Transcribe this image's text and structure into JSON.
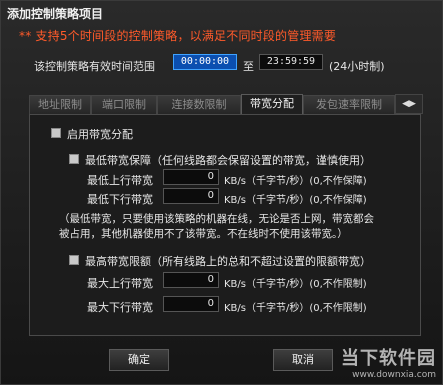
{
  "window": {
    "title": "添加控制策略项目"
  },
  "notice": "** 支持5个时间段的控制策略，以满足不同时段的管理需要",
  "time_range": {
    "label": "该控制策略有效时间范围",
    "start": "00:00:00",
    "to": "至",
    "end": "23:59:59",
    "hint": "(24小时制)"
  },
  "tabs": [
    "地址限制",
    "端口限制",
    "连接数限制",
    "带宽分配",
    "发包速率限制"
  ],
  "selected_tab": "带宽分配",
  "bandwidth": {
    "enable_label": "启用带宽分配",
    "min": {
      "label": "最低带宽保障（任何线路都会保留设置的带宽，谨慎使用）",
      "up_label": "最低上行带宽",
      "up_value": "0",
      "down_label": "最低下行带宽",
      "down_value": "0",
      "unit": "KB/s（千字节/秒）(0,不作保障)",
      "note_line1": "（最低带宽，只要使用该策略的机器在线，无论是否上网，带宽都会",
      "note_line2": "被占用，其他机器使用不了该带宽。不在线时不使用该带宽。）"
    },
    "max": {
      "label": "最高带宽限额（所有线路上的总和不超过设置的限额带宽）",
      "up_label": "最大上行带宽",
      "up_value": "0",
      "down_label": "最大下行带宽",
      "down_value": "0",
      "unit": "KB/s（千字节/秒）(0,不作限制)"
    }
  },
  "buttons": {
    "ok": "确定",
    "cancel": "取消"
  },
  "watermark": {
    "name": "当下软件园",
    "url": "www.downxia.com"
  }
}
